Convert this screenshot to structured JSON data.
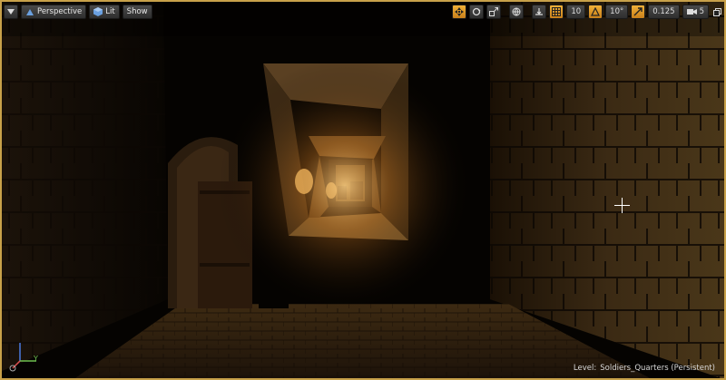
{
  "toolbar": {
    "menu_icon": "chevron-down-icon",
    "perspective_label": "Perspective",
    "lit_label": "Lit",
    "show_label": "Show",
    "grid_snap_value": "10",
    "rotation_snap_value": "10°",
    "scale_snap_value": "0.125",
    "camera_speed_value": "5",
    "accent_color": "#f0b038"
  },
  "status": {
    "level_label": "Level:",
    "level_name": "Soldiers_Quarters (Persistent)"
  },
  "axis": {
    "y_label": "Y"
  }
}
